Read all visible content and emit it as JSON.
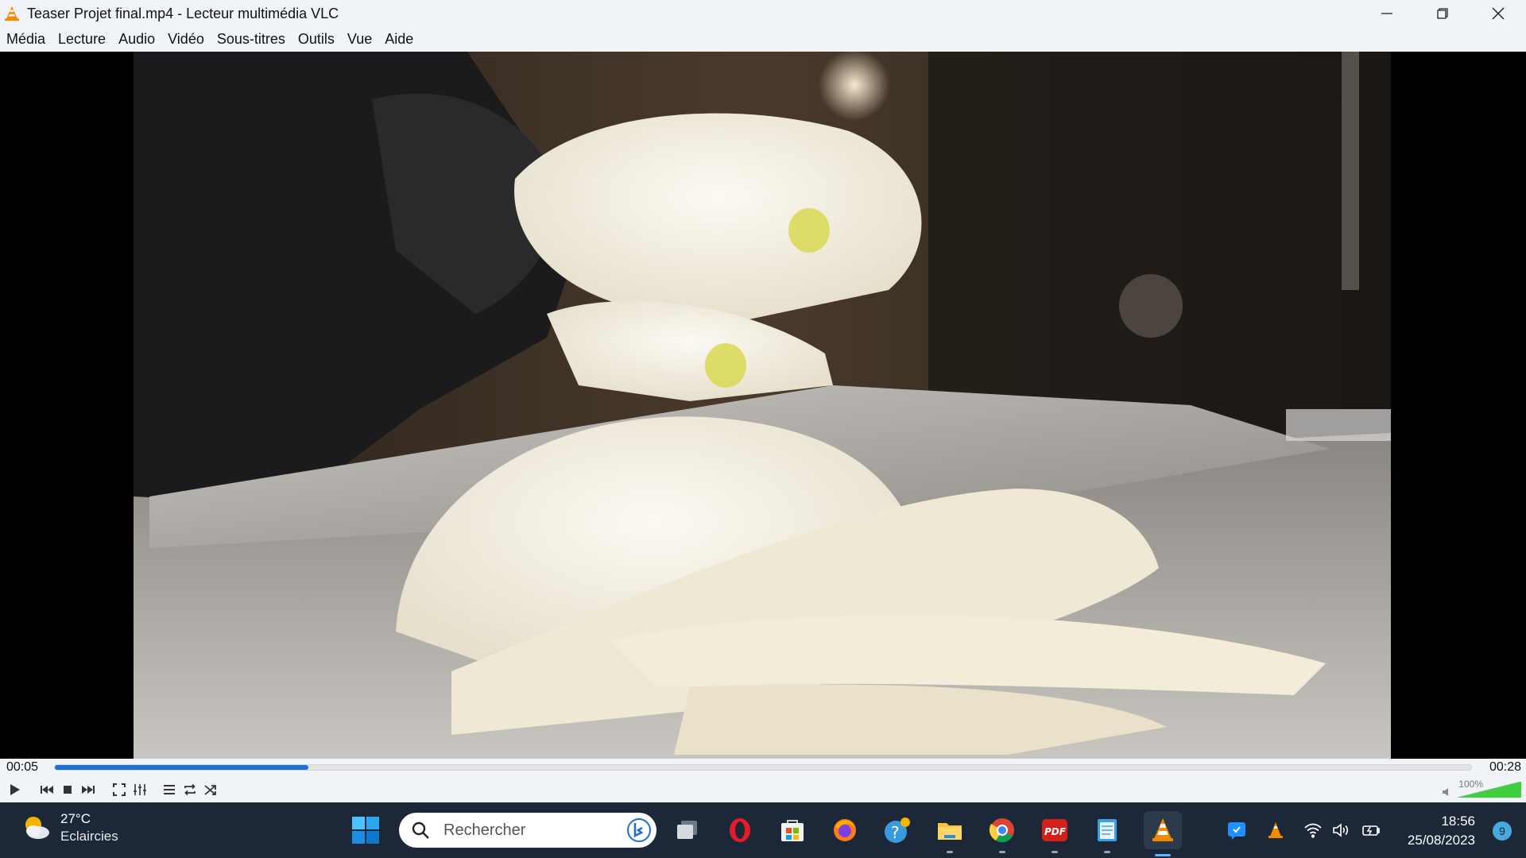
{
  "window": {
    "title": "Teaser Projet final.mp4 - Lecteur multimédia VLC"
  },
  "menu": [
    "Média",
    "Lecture",
    "Audio",
    "Vidéo",
    "Sous-titres",
    "Outils",
    "Vue",
    "Aide"
  ],
  "video": {
    "scene": "onion-slicing-frame"
  },
  "playback": {
    "elapsed": "00:05",
    "total": "00:28",
    "progress": 0.179
  },
  "volume": {
    "label": "100%",
    "level": 1.0
  },
  "controls": [
    "play-icon",
    "previous-icon",
    "stop-icon",
    "next-icon",
    "fullscreen-icon",
    "extended-settings-icon",
    "playlist-icon",
    "loop-icon",
    "shuffle-icon"
  ],
  "taskbar": {
    "weather": {
      "temp": "27°C",
      "condition": "Eclaircies"
    },
    "search_placeholder": "Rechercher",
    "apps": [
      "start-icon",
      "task-view-icon",
      "opera-icon",
      "microsoft-store-icon",
      "firefox-icon",
      "help-icon",
      "file-explorer-icon",
      "chrome-icon",
      "pdf-icon",
      "notepad-icon",
      "vlc-icon"
    ],
    "clock": {
      "time": "18:56",
      "date": "25/08/2023"
    },
    "notifications": "9"
  },
  "colors": {
    "accent": "#1a73d0",
    "taskbar": "#1c2838",
    "chrome_bg": "#f0f4f9"
  }
}
